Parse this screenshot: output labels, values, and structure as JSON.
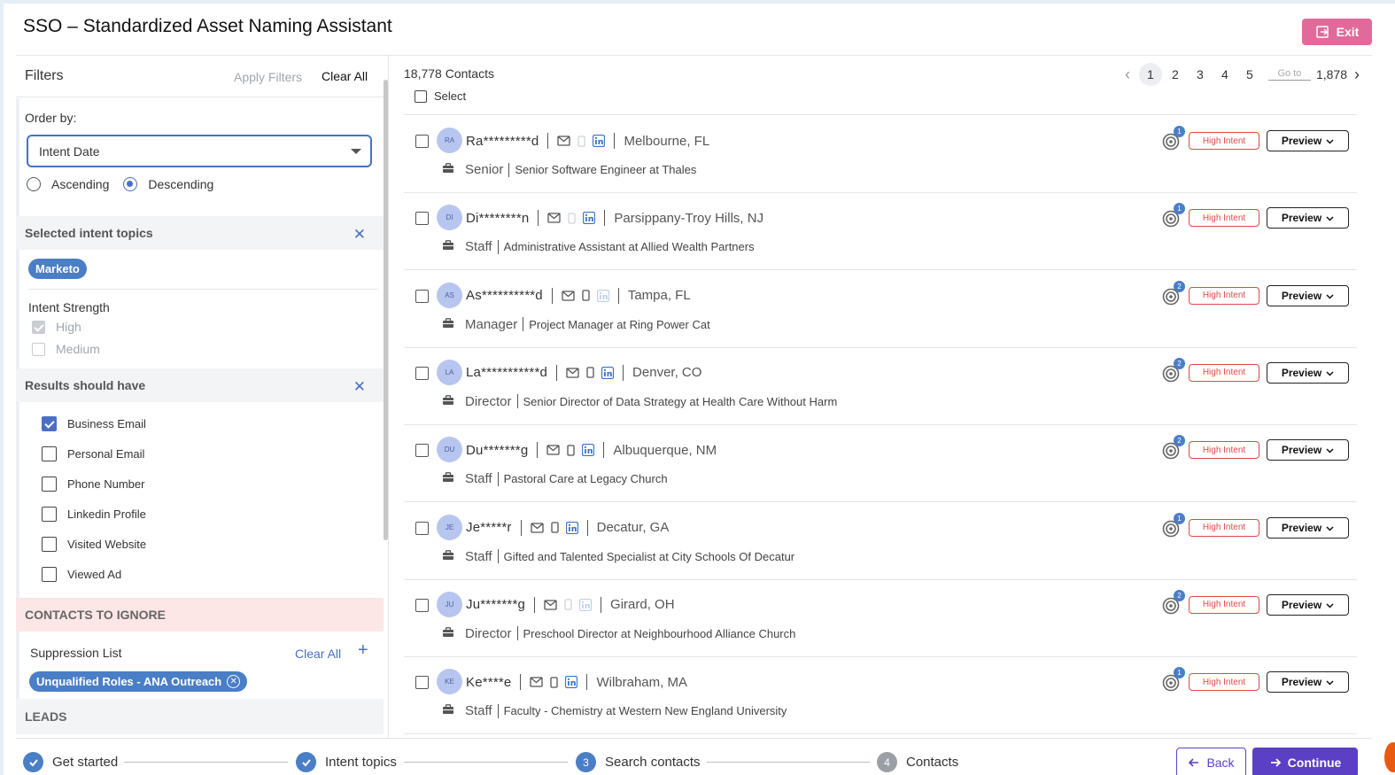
{
  "header": {
    "title": "SSO – Standardized Asset Naming Assistant",
    "exit_label": "Exit"
  },
  "filters": {
    "title": "Filters",
    "apply_label": "Apply Filters",
    "clear_all_label": "Clear All",
    "order_by_label": "Order by:",
    "order_by_value": "Intent Date",
    "ascending_label": "Ascending",
    "descending_label": "Descending",
    "selected_topics_title": "Selected intent topics",
    "topics": [
      "Marketo"
    ],
    "intent_strength_label": "Intent Strength",
    "strength_high": "High",
    "strength_medium": "Medium",
    "results_title": "Results should have",
    "results_options": [
      {
        "label": "Business Email",
        "checked": true
      },
      {
        "label": "Personal Email",
        "checked": false
      },
      {
        "label": "Phone Number",
        "checked": false
      },
      {
        "label": "Linkedin Profile",
        "checked": false
      },
      {
        "label": "Visited Website",
        "checked": false
      },
      {
        "label": "Viewed Ad",
        "checked": false
      }
    ],
    "ignore_title": "CONTACTS TO IGNORE",
    "suppression_label": "Suppression List",
    "suppression_clear": "Clear All",
    "suppression_plus": "+",
    "suppression_items": [
      "Unqualified Roles - ANA Outreach"
    ],
    "leads_title": "LEADS",
    "close_glyph": "✕",
    "pill_close_glyph": "✕"
  },
  "list": {
    "count_label": "18,778 Contacts",
    "select_label": "Select",
    "pager": {
      "pages": [
        "1",
        "2",
        "3",
        "4",
        "5"
      ],
      "current": "1",
      "goto_placeholder": "Go to",
      "last": "1,878",
      "prev": "‹",
      "next": "›"
    },
    "intent_label": "High Intent",
    "preview_label": "Preview",
    "rows": [
      {
        "initials": "RA",
        "name": "Ra*********d",
        "location": "Melbourne, FL",
        "level": "Senior",
        "job": "Senior Software Engineer at Thales",
        "badge": "1",
        "phone_on": false,
        "li_on": true
      },
      {
        "initials": "DI",
        "name": "Di********n",
        "location": "Parsippany-Troy Hills, NJ",
        "level": "Staff",
        "job": "Administrative Assistant at Allied Wealth Partners",
        "badge": "1",
        "phone_on": false,
        "li_on": true
      },
      {
        "initials": "AS",
        "name": "As**********d",
        "location": "Tampa, FL",
        "level": "Manager",
        "job": "Project Manager at Ring Power Cat",
        "badge": "2",
        "phone_on": true,
        "li_on": false
      },
      {
        "initials": "LA",
        "name": "La***********d",
        "location": "Denver, CO",
        "level": "Director",
        "job": "Senior Director of Data Strategy at Health Care Without Harm",
        "badge": "2",
        "phone_on": true,
        "li_on": true
      },
      {
        "initials": "DU",
        "name": "Du*******g",
        "location": "Albuquerque, NM",
        "level": "Staff",
        "job": "Pastoral Care at Legacy Church",
        "badge": "2",
        "phone_on": true,
        "li_on": true
      },
      {
        "initials": "JE",
        "name": "Je*****r",
        "location": "Decatur, GA",
        "level": "Staff",
        "job": "Gifted and Talented Specialist at City Schools Of Decatur",
        "badge": "1",
        "phone_on": true,
        "li_on": true
      },
      {
        "initials": "JU",
        "name": "Ju*******g",
        "location": "Girard, OH",
        "level": "Director",
        "job": "Preschool Director at Neighbourhood Alliance Church",
        "badge": "2",
        "phone_on": false,
        "li_on": false
      },
      {
        "initials": "KE",
        "name": "Ke****e",
        "location": "Wilbraham, MA",
        "level": "Staff",
        "job": "Faculty - Chemistry at Western New England University",
        "badge": "1",
        "phone_on": true,
        "li_on": true
      }
    ]
  },
  "stepper": {
    "steps": [
      {
        "num": "",
        "label": "Get started",
        "state": "done"
      },
      {
        "num": "",
        "label": "Intent topics",
        "state": "done"
      },
      {
        "num": "3",
        "label": "Search contacts",
        "state": "current"
      },
      {
        "num": "4",
        "label": "Contacts",
        "state": "todo"
      }
    ],
    "back_label": "Back",
    "continue_label": "Continue"
  },
  "colors": {
    "accent": "#4a7ec6",
    "primary": "#5b3fc4",
    "exit": "#e06a9a",
    "intent": "#e04848"
  }
}
